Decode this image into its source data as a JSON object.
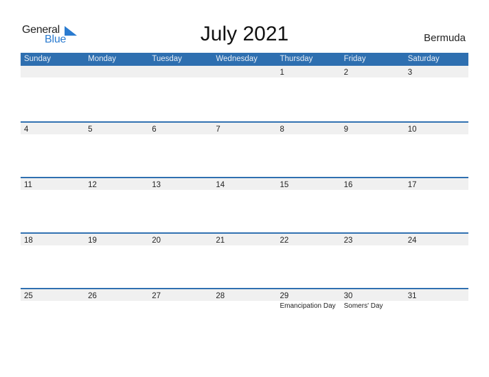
{
  "logo": {
    "line1": "General",
    "line2": "Blue",
    "accent_color": "#2a7bd0"
  },
  "header": {
    "title": "July 2021",
    "country": "Bermuda"
  },
  "colors": {
    "header_bar": "#2e6fb0",
    "date_strip": "#f0f0f0"
  },
  "weekdays": [
    "Sunday",
    "Monday",
    "Tuesday",
    "Wednesday",
    "Thursday",
    "Friday",
    "Saturday"
  ],
  "weeks": [
    {
      "days": [
        {
          "date": ""
        },
        {
          "date": ""
        },
        {
          "date": ""
        },
        {
          "date": ""
        },
        {
          "date": "1"
        },
        {
          "date": "2"
        },
        {
          "date": "3"
        }
      ]
    },
    {
      "days": [
        {
          "date": "4"
        },
        {
          "date": "5"
        },
        {
          "date": "6"
        },
        {
          "date": "7"
        },
        {
          "date": "8"
        },
        {
          "date": "9"
        },
        {
          "date": "10"
        }
      ]
    },
    {
      "days": [
        {
          "date": "11"
        },
        {
          "date": "12"
        },
        {
          "date": "13"
        },
        {
          "date": "14"
        },
        {
          "date": "15"
        },
        {
          "date": "16"
        },
        {
          "date": "17"
        }
      ]
    },
    {
      "days": [
        {
          "date": "18"
        },
        {
          "date": "19"
        },
        {
          "date": "20"
        },
        {
          "date": "21"
        },
        {
          "date": "22"
        },
        {
          "date": "23"
        },
        {
          "date": "24"
        }
      ]
    },
    {
      "days": [
        {
          "date": "25"
        },
        {
          "date": "26"
        },
        {
          "date": "27"
        },
        {
          "date": "28"
        },
        {
          "date": "29",
          "holiday": "Emancipation Day"
        },
        {
          "date": "30",
          "holiday": "Somers' Day"
        },
        {
          "date": "31"
        }
      ]
    }
  ]
}
